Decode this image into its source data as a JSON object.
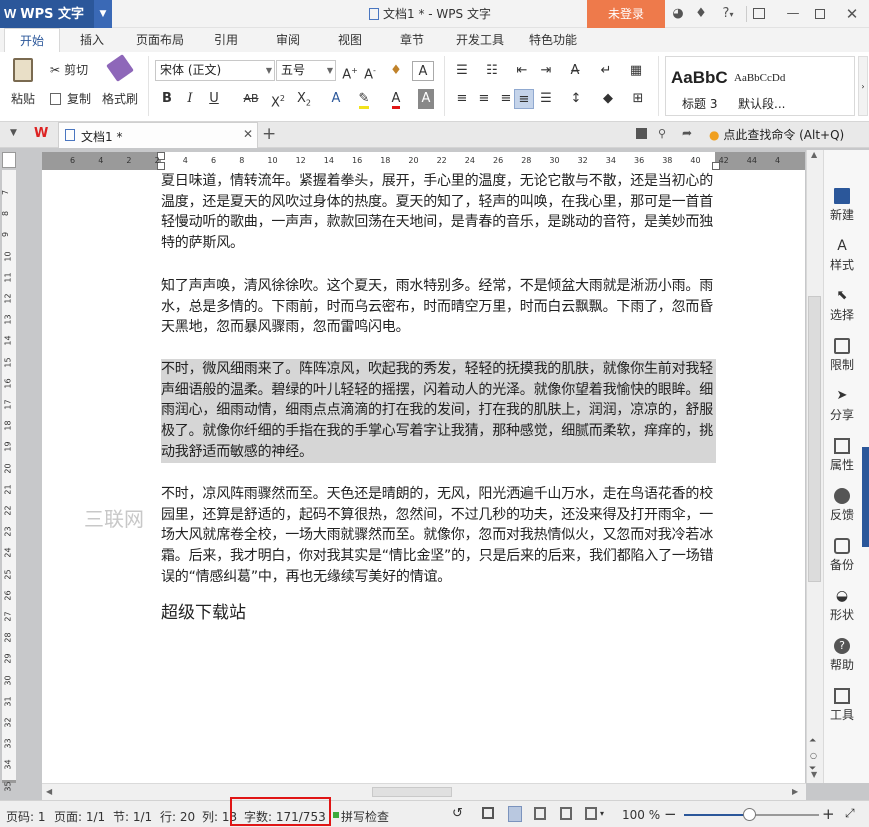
{
  "app": {
    "name": "WPS 文字",
    "window_title": "文档1 * - WPS 文字",
    "login_label": "未登录",
    "help_label": "?"
  },
  "ribbon_tabs": [
    "开始",
    "插入",
    "页面布局",
    "引用",
    "审阅",
    "视图",
    "章节",
    "开发工具",
    "特色功能"
  ],
  "ribbon": {
    "paste": "粘贴",
    "cut": "剪切",
    "copy": "复制",
    "format_painter": "格式刷",
    "font_name": "宋体 (正文)",
    "font_size": "五号",
    "style_preview_1": "AaBbC",
    "style_preview_2": "AaBbCcDd",
    "style_name_1": "标题 3",
    "style_name_2": "默认段..."
  },
  "doc_tabs": {
    "tab_label": "文档1 *",
    "search_command": "点此查找命令 (Alt+Q)"
  },
  "ruler": {
    "h_ticks": [
      "6",
      "4",
      "2",
      "2",
      "4",
      "6",
      "8",
      "10",
      "12",
      "14",
      "16",
      "18",
      "20",
      "22",
      "24",
      "26",
      "28",
      "30",
      "32",
      "34",
      "36",
      "38",
      "40",
      "42",
      "44",
      "4"
    ],
    "v_ticks": [
      "7",
      "8",
      "9",
      "10",
      "11",
      "12",
      "13",
      "14",
      "15",
      "16",
      "17",
      "18",
      "19",
      "20",
      "21",
      "22",
      "23",
      "24",
      "25",
      "26",
      "27",
      "28",
      "29",
      "30",
      "31",
      "32",
      "33",
      "34",
      "35"
    ]
  },
  "document": {
    "para1": "夏日味道，情转流年。紧握着拳头，展开，手心里的温度，无论它散与不散，还是当初心的温度，还是夏天的风吹过身体的热度。夏天的知了，轻声的叫唤，在我心里，那可是一首首轻慢动听的歌曲，一声声，款款回荡在天地间，是青春的音乐，是跳动的音符，是美妙而独特的萨斯风。",
    "para2": "知了声声唤，清风徐徐吹。这个夏天，雨水特别多。经常，不是倾盆大雨就是淅沥小雨。雨水，总是多情的。下雨前，时而乌云密布，时而晴空万里，时而白云飘飘。下雨了，忽而昏天黑地，忽而暴风骤雨，忽而雷鸣闪电。",
    "para3": "不时，微风细雨来了。阵阵凉风，吹起我的秀发，轻轻的抚摸我的肌肤，就像你生前对我轻声细语般的温柔。碧绿的叶儿轻轻的摇摆，闪着动人的光泽。就像你望着我愉快的眼眸。细雨润心，细雨动情，细雨点点滴滴的打在我的发间，打在我的肌肤上，润润，凉凉的，舒服极了。就像你纤细的手指在我的手掌心写着字让我猜，那种感觉，细腻而柔软，痒痒的，挑动我舒适而敏感的神经。",
    "para4": "不时，凉风阵雨骤然而至。天色还是晴朗的，无风，阳光洒遍千山万水，走在鸟语花香的校园里，还算是舒适的，起码不算很热，忽然间，不过几秒的功夫，还没来得及打开雨伞，一场大风就席卷全校，一场大雨就骤然而至。就像你，忽而对我热情似火，又忽而对我冷若冰霜。后来，我才明白，你对我其实是“情比金坚”的，只是后来的后来，我们都陷入了一场错误的“情感纠葛”中，再也无缘续写美好的情谊。",
    "heading": "超级下载站",
    "watermark": "三联网"
  },
  "right_pane": [
    "新建",
    "样式",
    "选择",
    "限制",
    "分享",
    "属性",
    "反馈",
    "备份",
    "形状",
    "帮助",
    "工具"
  ],
  "status": {
    "page": "页码: 1",
    "pages": "页面: 1/1",
    "section": "节: 1/1",
    "row": "行: 20",
    "col": "列: 13",
    "wordcount": "字数: 171/753",
    "spellcheck": "拼写检查",
    "zoom": "100 %"
  },
  "colors": {
    "accent": "#2b579a",
    "login": "#ee7a4b",
    "selection": "#d6d6d6",
    "highlight_box": "#e01515"
  }
}
